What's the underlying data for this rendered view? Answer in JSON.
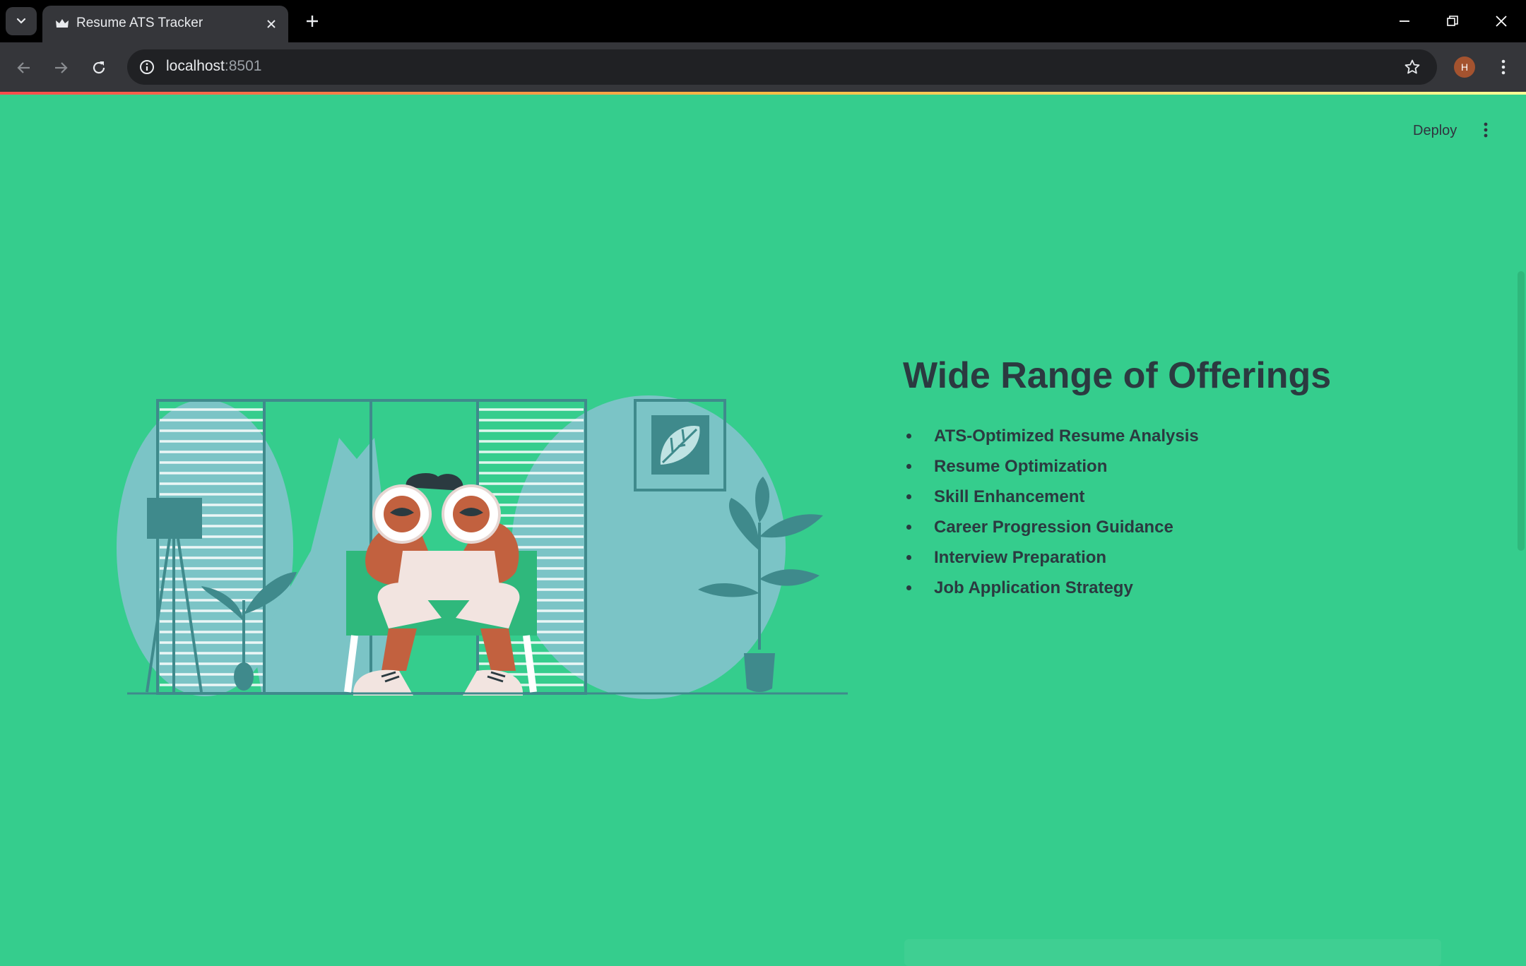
{
  "browser": {
    "tab_title": "Resume ATS Tracker",
    "url_host": "localhost",
    "url_port": ":8501",
    "profile_initial": "H"
  },
  "app": {
    "deploy_label": "Deploy"
  },
  "main": {
    "heading": "Wide Range of Offerings",
    "offerings": [
      "ATS-Optimized Resume Analysis",
      "Resume Optimization",
      "Skill Enhancement",
      "Career Progression Guidance",
      "Interview Preparation",
      "Job Application Strategy"
    ]
  },
  "colors": {
    "page_background": "#35cd8d",
    "text": "#2b3a40",
    "illustration_teal": "#7bc4c6",
    "illustration_dark": "#3f8a8c"
  },
  "icons": [
    "tab-search-icon",
    "crown-favicon-icon",
    "close-icon",
    "plus-icon",
    "minimize-icon",
    "restore-icon",
    "back-arrow-icon",
    "forward-arrow-icon",
    "reload-icon",
    "info-icon",
    "star-icon",
    "more-vert-icon"
  ]
}
